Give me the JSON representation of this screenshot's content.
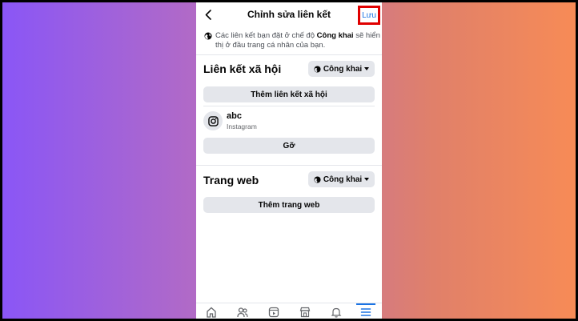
{
  "header": {
    "title": "Chỉnh sửa liên kết",
    "save_label": "Lưu"
  },
  "notice": {
    "text_before": "Các liên kết bạn đặt ở chế độ",
    "highlight": "Công khai",
    "text_after": "sẽ hiển thị ở đầu trang cá nhân của bạn."
  },
  "social": {
    "title": "Liên kết xã hội",
    "privacy_label": "Công khai",
    "add_label": "Thêm liên kết xã hội",
    "items": [
      {
        "name": "abc",
        "platform": "Instagram",
        "icon": "instagram-icon"
      }
    ],
    "remove_label": "Gỡ"
  },
  "website": {
    "title": "Trang web",
    "privacy_label": "Công khai",
    "add_label": "Thêm trang web"
  },
  "tabbar": {
    "tabs": [
      "home-icon",
      "friends-icon",
      "video-icon",
      "marketplace-icon",
      "bell-icon",
      "menu-icon"
    ],
    "active": "menu-icon"
  },
  "colors": {
    "accent": "#1b74e4",
    "highlight_box": "#e00000",
    "button_bg": "#e4e6eb"
  }
}
